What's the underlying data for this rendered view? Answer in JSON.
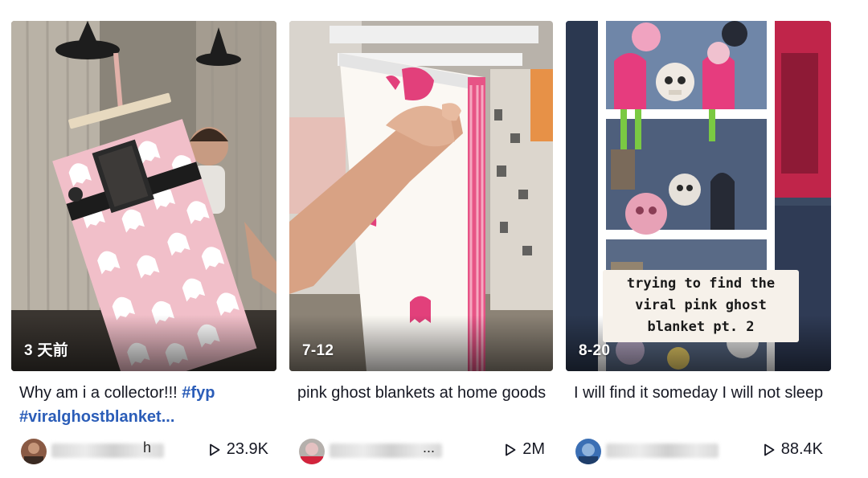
{
  "videos": [
    {
      "timestamp": "3 天前",
      "title": "Why am i a collector!!!",
      "hashtags": "#fyp #viralghostblanket...",
      "author_visible_tail": "h",
      "play_count": "23.9K"
    },
    {
      "timestamp": "7-12",
      "title": "pink ghost blankets at home goods",
      "hashtags": "",
      "author_visible_tail": "...",
      "play_count": "2M"
    },
    {
      "timestamp": "8-20",
      "title": "I will find it someday I will not sleep",
      "hashtags": "",
      "author_visible_tail": "",
      "play_count": "88.4K",
      "overlay_caption": "trying to find the\nviral pink ghost\nblanket pt. 2"
    }
  ],
  "icons": {
    "play": "play-icon"
  },
  "colors": {
    "hashtag": "#2b5db8",
    "text": "#161823",
    "ghost_pink": "#e88aa6"
  }
}
